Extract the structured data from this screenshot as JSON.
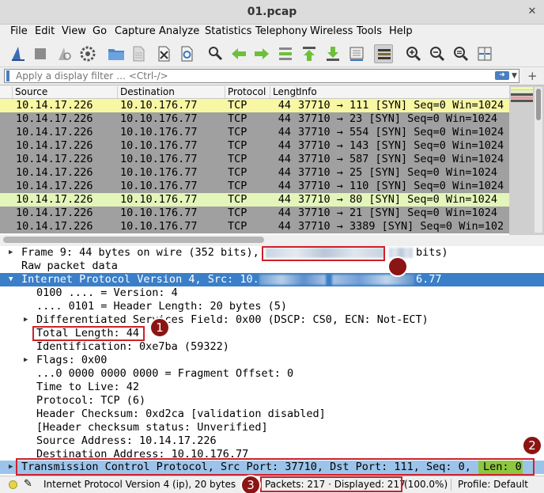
{
  "window": {
    "title": "01.pcap"
  },
  "menu": [
    "File",
    "Edit",
    "View",
    "Go",
    "Capture",
    "Analyze",
    "Statistics",
    "Telephony",
    "Wireless",
    "Tools",
    "Help"
  ],
  "toolbar": {
    "icons": [
      "shark-fin-start-icon",
      "stop-icon",
      "restart-icon",
      "options-gear-icon",
      "open-folder-icon",
      "file-icon",
      "close-file-icon",
      "reload-icon",
      "find-icon",
      "go-back-icon",
      "go-forward-icon",
      "go-to-packet-icon",
      "first-packet-icon",
      "last-packet-icon",
      "autoscroll-icon",
      "colorize-icon",
      "zoom-in-icon",
      "zoom-out-icon",
      "zoom-normal-icon",
      "resize-columns-icon"
    ]
  },
  "filter": {
    "placeholder": "Apply a display filter … <Ctrl-/>"
  },
  "packet_list": {
    "columns": [
      "Source",
      "Destination",
      "Protocol",
      "Lengt",
      "Info"
    ],
    "rows": [
      {
        "source": "10.14.17.226",
        "destination": "10.10.176.77",
        "protocol": "TCP",
        "length": "44",
        "info": "37710 → 111 [SYN] Seq=0 Win=1024",
        "bg": "#f7f7a4"
      },
      {
        "source": "10.14.17.226",
        "destination": "10.10.176.77",
        "protocol": "TCP",
        "length": "44",
        "info": "37710 → 23 [SYN] Seq=0 Win=1024",
        "bg": "#a0a0a0"
      },
      {
        "source": "10.14.17.226",
        "destination": "10.10.176.77",
        "protocol": "TCP",
        "length": "44",
        "info": "37710 → 554 [SYN] Seq=0 Win=1024",
        "bg": "#a0a0a0"
      },
      {
        "source": "10.14.17.226",
        "destination": "10.10.176.77",
        "protocol": "TCP",
        "length": "44",
        "info": "37710 → 143 [SYN] Seq=0 Win=1024",
        "bg": "#a0a0a0"
      },
      {
        "source": "10.14.17.226",
        "destination": "10.10.176.77",
        "protocol": "TCP",
        "length": "44",
        "info": "37710 → 587 [SYN] Seq=0 Win=1024",
        "bg": "#a0a0a0"
      },
      {
        "source": "10.14.17.226",
        "destination": "10.10.176.77",
        "protocol": "TCP",
        "length": "44",
        "info": "37710 → 25 [SYN] Seq=0 Win=1024",
        "bg": "#a0a0a0"
      },
      {
        "source": "10.14.17.226",
        "destination": "10.10.176.77",
        "protocol": "TCP",
        "length": "44",
        "info": "37710 → 110 [SYN] Seq=0 Win=1024",
        "bg": "#a0a0a0"
      },
      {
        "source": "10.14.17.226",
        "destination": "10.10.176.77",
        "protocol": "TCP",
        "length": "44",
        "info": "37710 → 80 [SYN] Seq=0 Win=1024",
        "bg": "#e4f5b9"
      },
      {
        "source": "10.14.17.226",
        "destination": "10.10.176.77",
        "protocol": "TCP",
        "length": "44",
        "info": "37710 → 21 [SYN] Seq=0 Win=1024",
        "bg": "#a0a0a0"
      },
      {
        "source": "10.14.17.226",
        "destination": "10.10.176.77",
        "protocol": "TCP",
        "length": "44",
        "info": "37710 → 3389 [SYN] Seq=0 Win=102",
        "bg": "#a0a0a0"
      }
    ]
  },
  "details": {
    "frame": "Frame 9: 44 bytes on wire (352 bits),",
    "frame_tail": "bits)",
    "raw": "Raw packet data",
    "ip_header": "Internet Protocol Version 4, Src: 10.",
    "ip_tail": "6.77",
    "version": "0100 .... = Version: 4",
    "header_length": ".... 0101 = Header Length: 20 bytes (5)",
    "dsfield": "Differentiated Services Field: 0x00 (DSCP: CS0, ECN: Not-ECT)",
    "total_length": "Total Length: 44",
    "identification": "Identification: 0xe7ba (59322)",
    "flags": "Flags: 0x00",
    "frag_offset": "...0 0000 0000 0000 = Fragment Offset: 0",
    "ttl": "Time to Live: 42",
    "protocol": "Protocol: TCP (6)",
    "checksum": "Header Checksum: 0xd2ca [validation disabled]",
    "checksum_status": "[Header checksum status: Unverified]",
    "src": "Source Address: 10.14.17.226",
    "dst": "Destination Address: 10.10.176.77",
    "tcp": "Transmission Control Protocol, Src Port: 37710, Dst Port: 111, Seq: 0,",
    "tcp_len": "Len: 0"
  },
  "annotations": [
    "1",
    "2",
    "3"
  ],
  "status": {
    "field": "Internet Protocol Version 4 (ip), 20 bytes",
    "packets": "Packets: 217 · Displayed: 217",
    "percent": "(100.0%)",
    "profile": "Profile: Default"
  },
  "colors": {
    "selection": "#3a7fc7",
    "tcp_selected": "#9cc4ea",
    "len_highlight": "#8dc63f",
    "annotation_red": "#d0202a",
    "badge": "#8b1414"
  }
}
